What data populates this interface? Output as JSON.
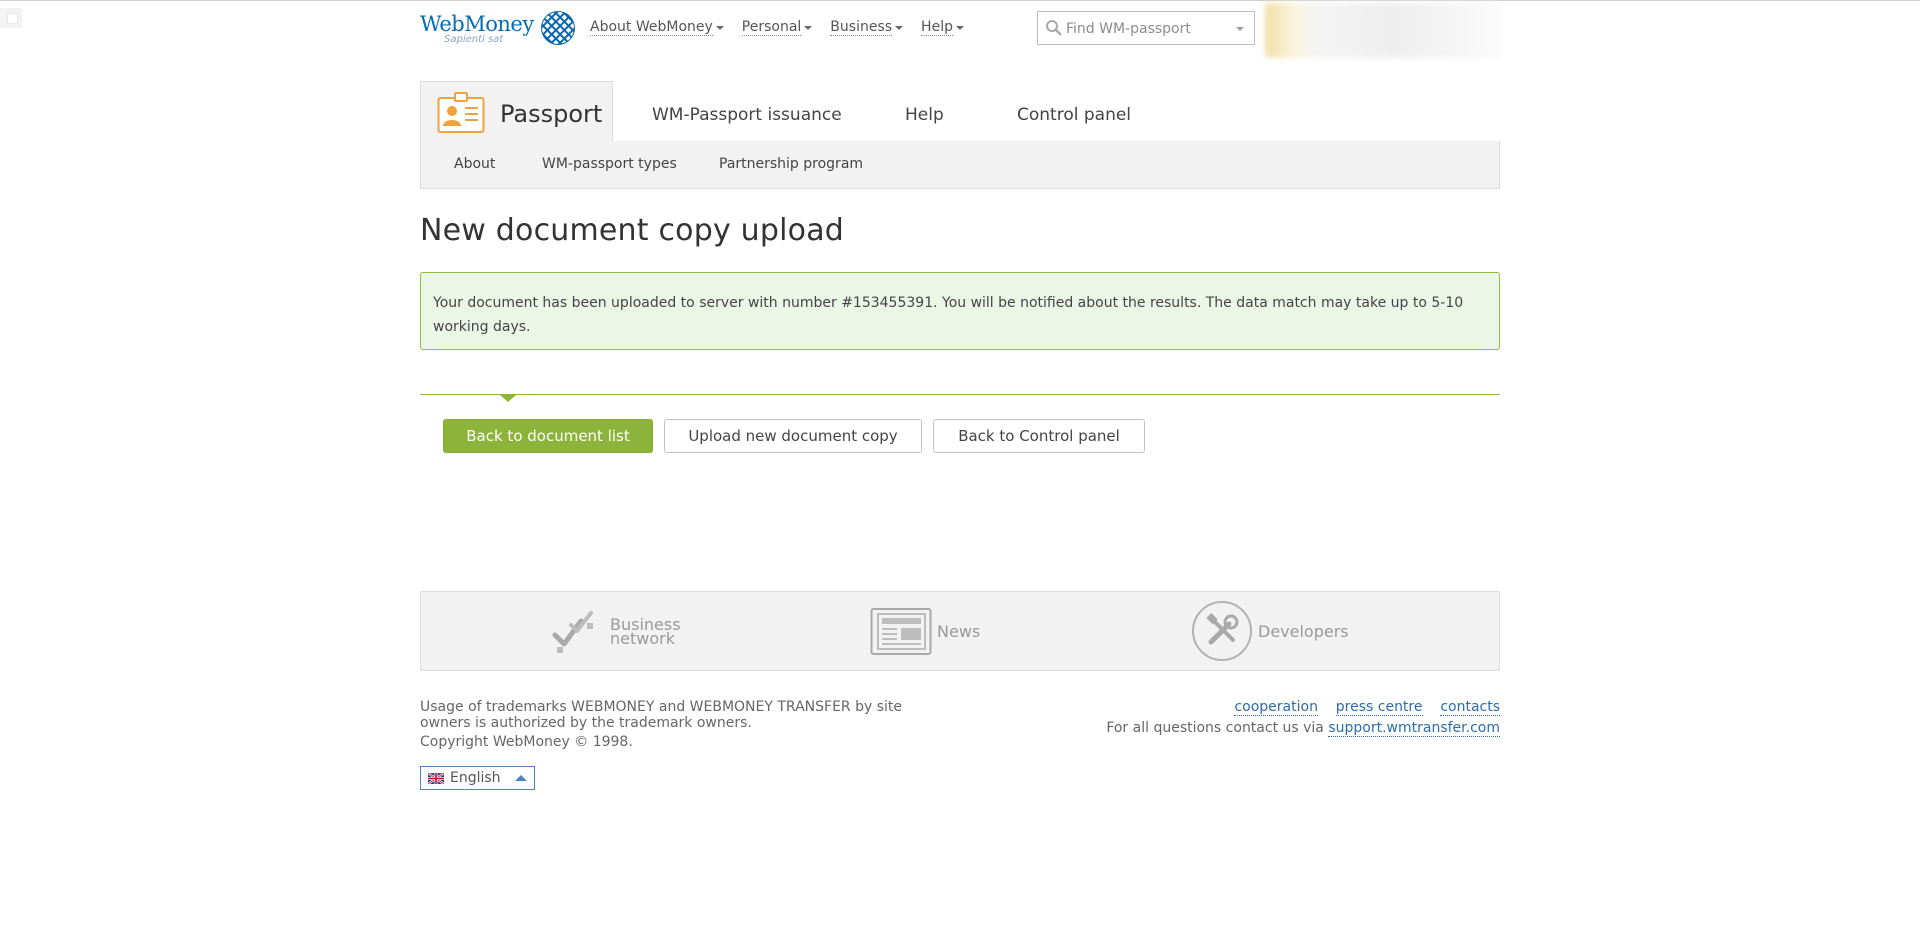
{
  "header": {
    "logo_text": "WebMoney",
    "logo_sub": "Sapienti sat",
    "nav": [
      {
        "label": "About WebMoney"
      },
      {
        "label": "Personal"
      },
      {
        "label": "Business"
      },
      {
        "label": "Help"
      }
    ],
    "search": {
      "placeholder": "Find WM-passport",
      "value": ""
    }
  },
  "tabs": {
    "active": {
      "label": "Passport"
    },
    "items": [
      {
        "label": "WM-Passport issuance"
      },
      {
        "label": "Help"
      },
      {
        "label": "Control panel"
      }
    ],
    "sub": [
      {
        "label": "About"
      },
      {
        "label": "WM-passport types"
      },
      {
        "label": "Partnership program"
      }
    ]
  },
  "page": {
    "title": "New document copy upload",
    "notice": "Your document has been uploaded to server with number #153455391. You will be notified about the results. The data match may take up to 5-10 working days."
  },
  "actions": {
    "back_to_list": "Back to document list",
    "upload_new": "Upload new document copy",
    "back_to_panel": "Back to Control panel"
  },
  "footer_panel": {
    "business_line1": "Business",
    "business_line2": "network",
    "news": "News",
    "developers": "Developers"
  },
  "footer": {
    "trademark": "Usage of trademarks WEBMONEY and WEBMONEY TRANSFER by site owners is authorized by the trademark owners.",
    "copyright": "Copyright WebMoney © 1998.",
    "links": [
      {
        "label": "cooperation"
      },
      {
        "label": "press centre"
      },
      {
        "label": "contacts"
      }
    ],
    "contact_text": "For all questions contact us via",
    "support_link": "support.wmtransfer.com",
    "language": "English"
  },
  "colors": {
    "brand_blue": "#036cb4",
    "accent_green": "#8cb43a",
    "notice_bg": "#ecf6e7",
    "link_blue": "#2a6db0",
    "passport_orange": "#f0a23c"
  }
}
